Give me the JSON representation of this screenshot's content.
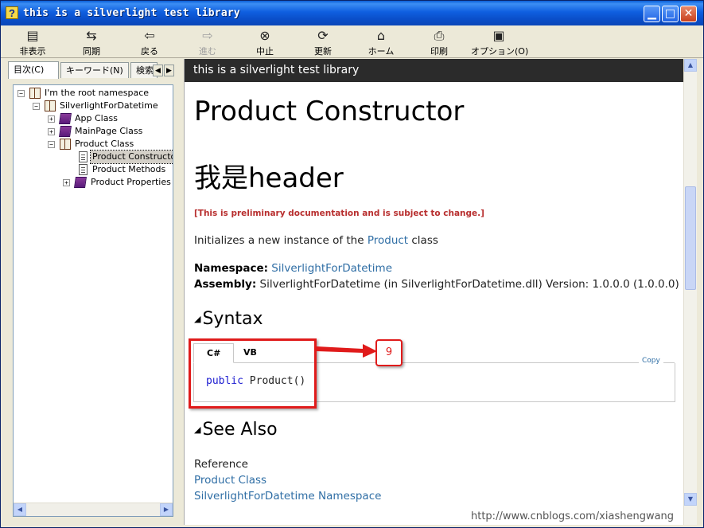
{
  "window": {
    "title": "this is a silverlight test library",
    "title_icon": "help-question-icon",
    "caption_buttons": [
      "minimize",
      "maximize",
      "close"
    ]
  },
  "toolbar": {
    "items": [
      {
        "label": "非表示",
        "icon": "hide-pane-icon",
        "enabled": true
      },
      {
        "label": "同期",
        "icon": "sync-icon",
        "enabled": true
      },
      {
        "label": "戻る",
        "icon": "back-arrow-icon",
        "enabled": true
      },
      {
        "label": "進む",
        "icon": "forward-arrow-icon",
        "enabled": false
      },
      {
        "label": "中止",
        "icon": "stop-icon",
        "enabled": true
      },
      {
        "label": "更新",
        "icon": "refresh-icon",
        "enabled": true
      },
      {
        "label": "ホーム",
        "icon": "home-icon",
        "enabled": true
      },
      {
        "label": "印刷",
        "icon": "print-icon",
        "enabled": true
      },
      {
        "label": "オプション(O)",
        "icon": "options-icon",
        "enabled": true
      }
    ]
  },
  "nav_tabs": [
    {
      "label": "目次(C)",
      "active": true
    },
    {
      "label": "キーワード(N)",
      "active": false
    },
    {
      "label": "検索",
      "active": false
    }
  ],
  "tree": [
    {
      "label": "I'm the root namespace",
      "expander": "−",
      "icon": "open-book"
    },
    {
      "label": "SilverlightForDatetime",
      "expander": "−",
      "icon": "open-book"
    },
    {
      "label": "App Class",
      "expander": "+",
      "icon": "closed-book"
    },
    {
      "label": "MainPage Class",
      "expander": "+",
      "icon": "closed-book"
    },
    {
      "label": "Product Class",
      "expander": "−",
      "icon": "open-book"
    },
    {
      "label": "Product Constructor",
      "expander": "",
      "icon": "page",
      "selected": true
    },
    {
      "label": "Product Methods",
      "expander": "",
      "icon": "page"
    },
    {
      "label": "Product Properties",
      "expander": "+",
      "icon": "closed-book"
    }
  ],
  "content": {
    "header_bar": "this is a silverlight test library",
    "title": "Product Constructor",
    "subtitle": "我是header",
    "prelim_note": "[This is preliminary documentation and is subject to change.]",
    "intro_prefix": "Initializes a new instance of the ",
    "intro_link": "Product",
    "intro_suffix": " class",
    "namespace_label": "Namespace:",
    "namespace_value": "SilverlightForDatetime",
    "assembly_label": "Assembly:",
    "assembly_value": "SilverlightForDatetime (in SilverlightForDatetime.dll) Version: 1.0.0.0 (1.0.0.0)",
    "syntax_heading": "Syntax",
    "code_tabs": [
      "C#",
      "VB"
    ],
    "copy_label": "Copy",
    "code_keyword": "public",
    "code_rest": " Product()",
    "see_also_heading": "See Also",
    "reference_label": "Reference",
    "links": [
      "Product Class",
      "SilverlightForDatetime Namespace"
    ],
    "callout_number": "9"
  },
  "watermark": "http://www.cnblogs.com/xiashengwang",
  "colors": {
    "titlebar": "#0a5fd8",
    "header_bar_bg": "#2b2b2b",
    "link": "#2f6ea5",
    "prelim": "#b82f2f",
    "annotation_red": "#e01b1b",
    "code_keyword": "#1c1cd0"
  }
}
